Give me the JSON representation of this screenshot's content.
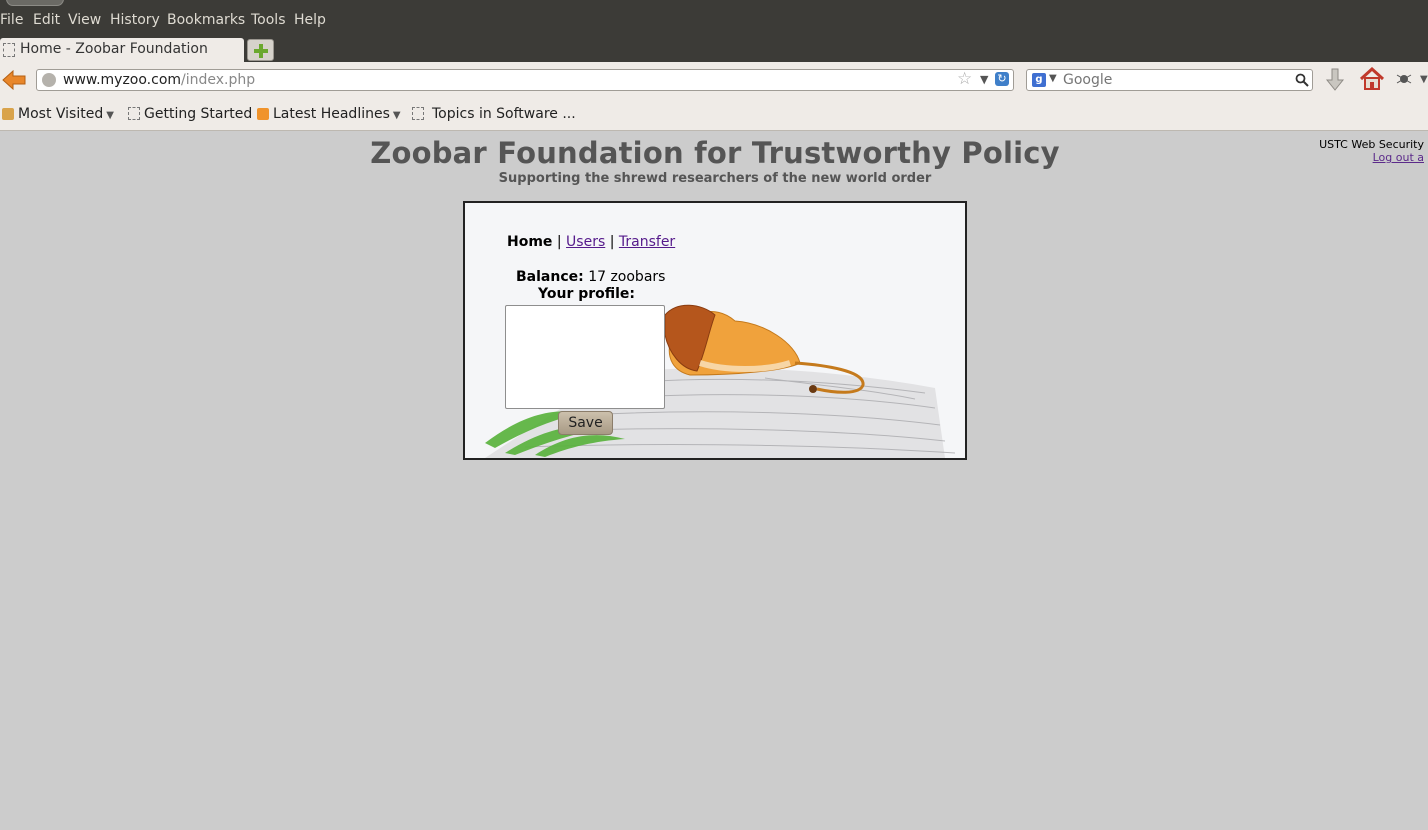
{
  "menubar": {
    "items": [
      "File",
      "Edit",
      "View",
      "History",
      "Bookmarks",
      "Tools",
      "Help"
    ]
  },
  "tab": {
    "title": "Home - Zoobar Foundation"
  },
  "navbar": {
    "url_host": "www.myzoo.com",
    "url_path": "/index.php",
    "search_placeholder": "Google"
  },
  "bookmarks": {
    "items": [
      "Most Visited",
      "Getting Started",
      "Latest Headlines",
      "Topics in Software ..."
    ]
  },
  "page": {
    "title": "Zoobar Foundation for Trustworthy Policy",
    "subtitle": "Supporting the shrewd researchers of the new world order",
    "login_text": "USTC Web Security",
    "logout_link": "Log out a",
    "nav": {
      "current": "Home",
      "separator": "|",
      "users": "Users",
      "transfer": "Transfer"
    },
    "balance_label": "Balance:",
    "balance_value": "17 zoobars",
    "profile_label": "Your profile:",
    "save_label": "Save"
  },
  "colors": {
    "chrome_dark": "#3c3b37",
    "chrome_light": "#efebe7",
    "page_bg": "#cccccc",
    "title_color": "#555555",
    "link_color": "#551a8b"
  }
}
